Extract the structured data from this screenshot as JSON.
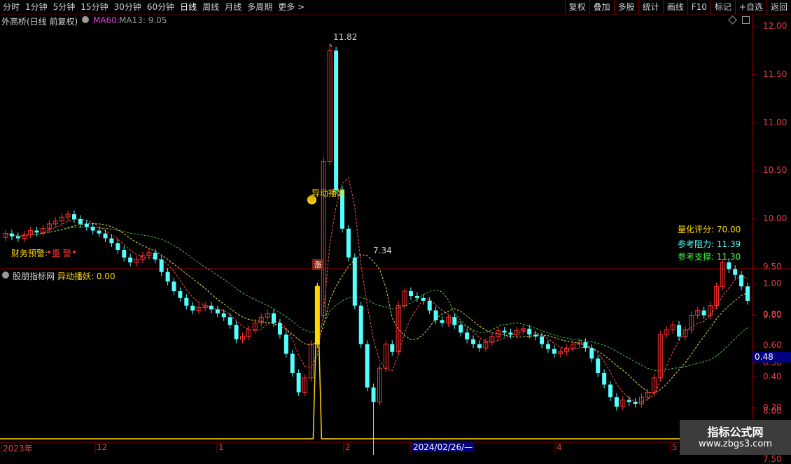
{
  "toolbar": {
    "left": [
      "分时",
      "1分钟",
      "5分钟",
      "15分钟",
      "30分钟",
      "60分钟",
      "日线",
      "周线",
      "月线",
      "多周期",
      "更多 >"
    ],
    "active": "日线",
    "right": [
      "复权",
      "叠加",
      "多股",
      "统计",
      "画线",
      "F10",
      "标记",
      "+自选",
      "返回"
    ]
  },
  "main": {
    "stock": "外高桥(日线 前复权)",
    "ma60": "MA60:",
    "ma13": "MA13: 9.05",
    "high_label": "11.82",
    "low_label": "7.34",
    "signal_text": "异动播妖",
    "warn_label": "财务预警:",
    "warn_value": "重 警",
    "tag": "涨",
    "score_label": "量化评分: 70.00",
    "resist_label": "参考阻力: 11.39",
    "support_label": "参考支撑: 11.30",
    "y_ticks": [
      "12.00",
      "11.50",
      "11.00",
      "10.50",
      "10.00",
      "9.50",
      "9.00",
      "8.50",
      "8.00",
      "7.50"
    ]
  },
  "sub": {
    "title": "股朋指标网",
    "indicator": "异动播妖: 0.00",
    "y_ticks": [
      "1.00",
      "0.80",
      "0.60",
      "0.40",
      "0.20"
    ],
    "cursor_value": "0.48"
  },
  "x_axis": {
    "labels": [
      "2023年",
      "12",
      "1",
      "2",
      "2024/02/26/—",
      "4",
      "5"
    ]
  },
  "watermark": {
    "title": "指标公式网",
    "url": "www.zbgs3.com"
  },
  "colors": {
    "up": "#ff3030",
    "down": "#54ffff",
    "signal": "#ffd700",
    "accent": "#ff3c3c"
  },
  "chart_data": {
    "type": "candlestick",
    "series": [
      {
        "name": "MA13",
        "last": 9.05
      }
    ],
    "price_range": [
      7.3,
      12.1
    ],
    "high": 11.82,
    "low": 7.34,
    "indicator_range": [
      0,
      1.05
    ],
    "indicator_spike": 1.0
  }
}
